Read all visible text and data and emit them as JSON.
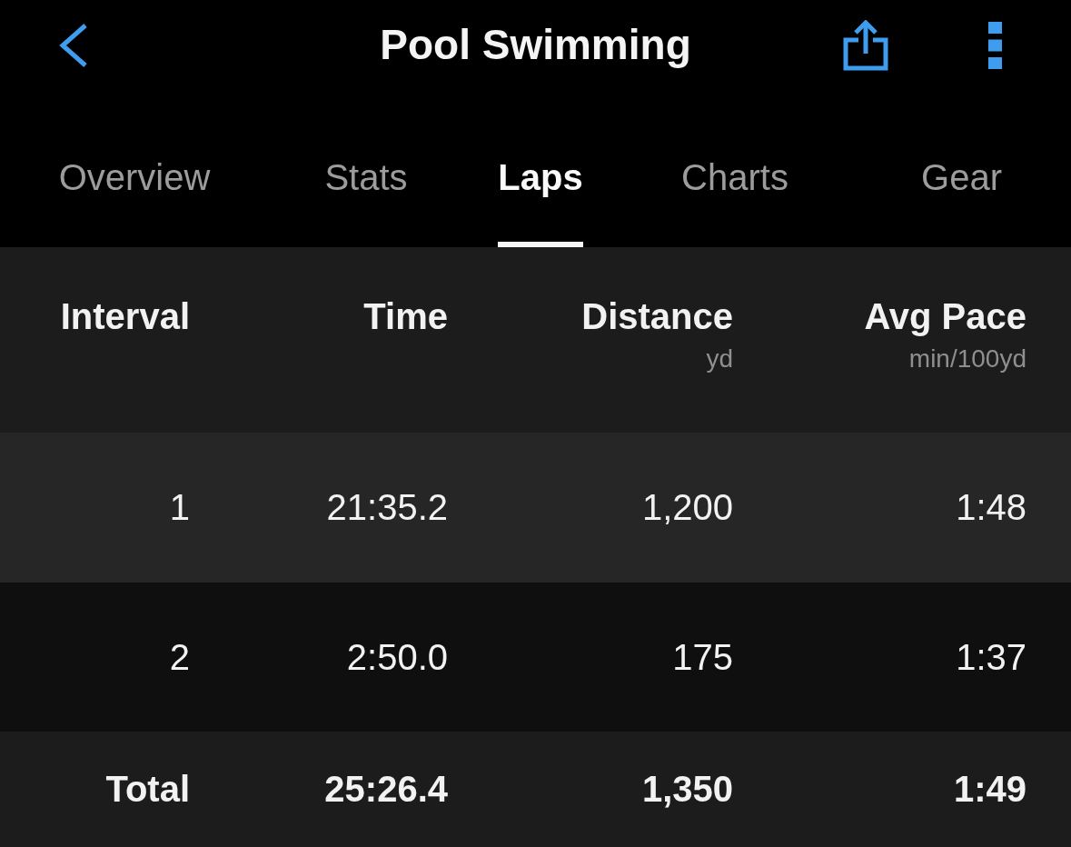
{
  "header": {
    "title": "Pool Swimming"
  },
  "tabs": [
    {
      "label": "Overview",
      "selected": false
    },
    {
      "label": "Stats",
      "selected": false
    },
    {
      "label": "Laps",
      "selected": true
    },
    {
      "label": "Charts",
      "selected": false
    },
    {
      "label": "Gear",
      "selected": false
    }
  ],
  "table": {
    "columns": [
      {
        "label": "Interval"
      },
      {
        "label": "Time"
      },
      {
        "label": "Distance",
        "unit": "yd"
      },
      {
        "label": "Avg Pace",
        "unit": "min/100yd"
      }
    ],
    "rows": [
      {
        "kind": "lap",
        "cells": [
          "1",
          "21:35.2",
          "1,200",
          "1:48"
        ]
      },
      {
        "kind": "lap",
        "cells": [
          "2",
          "2:50.0",
          "175",
          "1:37"
        ]
      },
      {
        "kind": "total",
        "cells": [
          "Total",
          "25:26.4",
          "1,350",
          "1:49"
        ]
      }
    ]
  }
}
